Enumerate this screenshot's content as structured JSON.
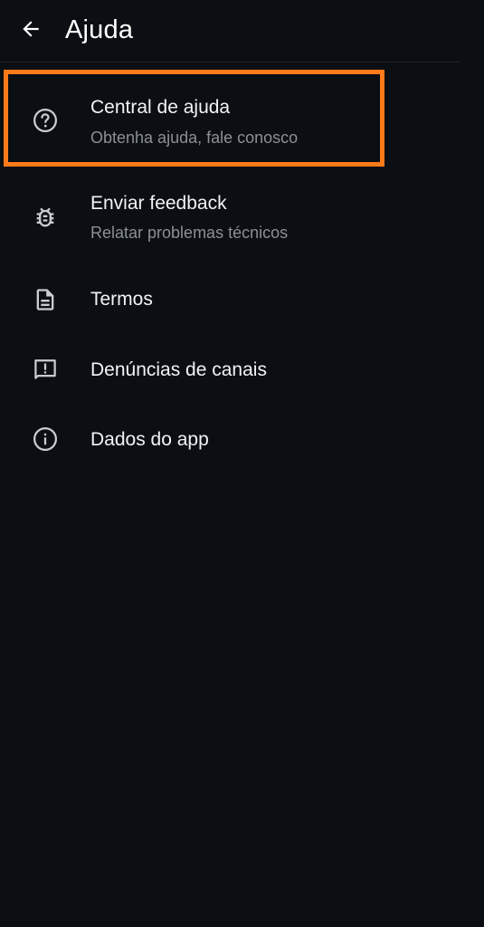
{
  "header": {
    "title": "Ajuda",
    "back_icon": "arrow-back-icon"
  },
  "menu": {
    "items": [
      {
        "label": "Central de ajuda",
        "sublabel": "Obtenha ajuda, fale conosco",
        "icon": "help-circle-icon"
      },
      {
        "label": "Enviar feedback",
        "sublabel": "Relatar problemas técnicos",
        "icon": "bug-icon"
      },
      {
        "label": "Termos",
        "icon": "document-icon"
      },
      {
        "label": "Denúncias de canais",
        "icon": "report-icon"
      },
      {
        "label": "Dados do app",
        "icon": "info-icon"
      }
    ]
  },
  "colors": {
    "background": "#0b0e12",
    "highlight": "#ff7a1a",
    "primary_text": "#f2f3f5",
    "secondary_text": "#8b9096"
  }
}
